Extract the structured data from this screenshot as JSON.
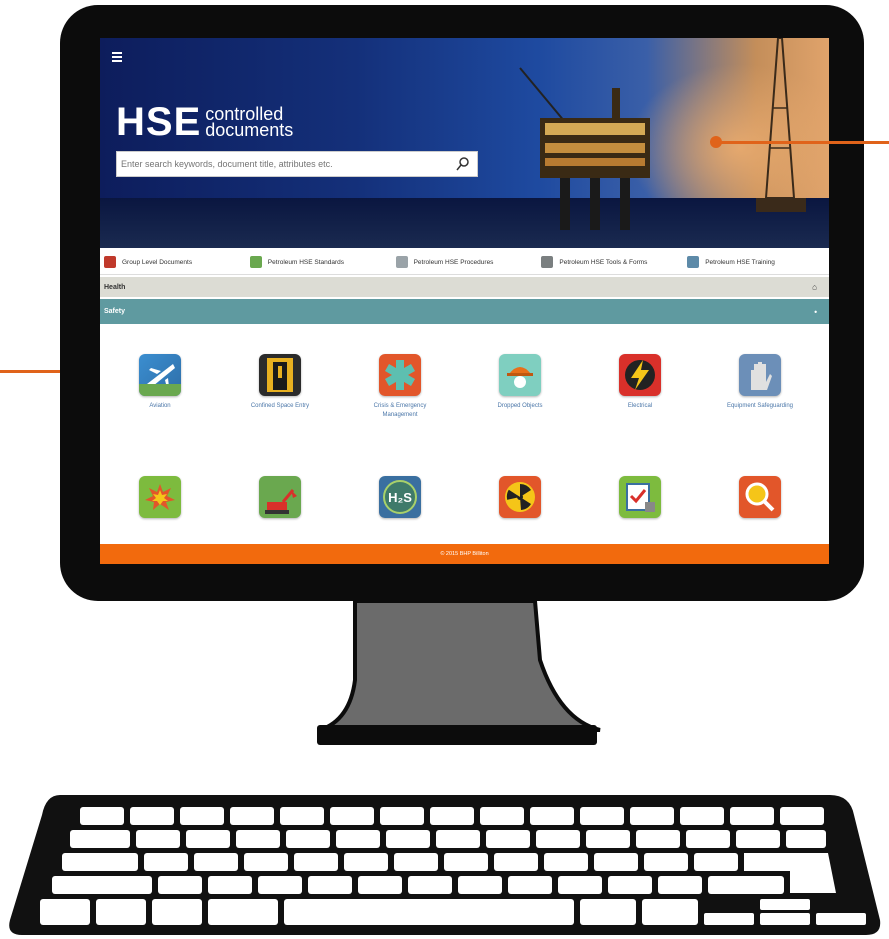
{
  "header": {
    "logo_big": "HSE",
    "logo_small_line1": "controlled",
    "logo_small_line2": "documents",
    "search_placeholder": "Enter search keywords, document title, attributes etc.",
    "menu_icon": "hamburger-icon",
    "search_icon": "magnifier-icon"
  },
  "nav": {
    "tabs": [
      {
        "label": "Group Level Documents",
        "icon": "folder-red-icon",
        "color": "#c0392b"
      },
      {
        "label": "Petroleum HSE Standards",
        "icon": "standards-icon",
        "color": "#6aa84f"
      },
      {
        "label": "Petroleum HSE Procedures",
        "icon": "procedures-icon",
        "color": "#9aa3a8"
      },
      {
        "label": "Petroleum HSE Tools & Forms",
        "icon": "tools-icon",
        "color": "#7a7f80"
      },
      {
        "label": "Petroleum HSE Training",
        "icon": "training-icon",
        "color": "#5d8aa8"
      }
    ]
  },
  "sections": {
    "health": "Health",
    "safety": "Safety"
  },
  "tiles": [
    {
      "label": "Aviation",
      "icon": "airplane-icon",
      "color": "#3b8ed0"
    },
    {
      "label": "Confined Space Entry",
      "icon": "confined-space-icon",
      "color": "#2b2b2b"
    },
    {
      "label": "Crisis & Emergency Management",
      "icon": "star-of-life-icon",
      "color": "#e2562a"
    },
    {
      "label": "Dropped Objects",
      "icon": "hardhat-icon",
      "color": "#7fcfc0"
    },
    {
      "label": "Electrical",
      "icon": "lightning-icon",
      "color": "#d9302a"
    },
    {
      "label": "Equipment Safeguarding",
      "icon": "glove-icon",
      "color": "#6c8fb8"
    },
    {
      "label": "",
      "icon": "explosion-icon",
      "color": "#7dbb3e"
    },
    {
      "label": "",
      "icon": "excavator-icon",
      "color": "#6aa84f"
    },
    {
      "label": "",
      "icon": "h2s-icon",
      "color": "#3f7a6a"
    },
    {
      "label": "",
      "icon": "radiation-icon",
      "color": "#e2562a"
    },
    {
      "label": "",
      "icon": "permit-icon",
      "color": "#7dbb3e"
    },
    {
      "label": "",
      "icon": "magnifier-risk-icon",
      "color": "#e2562a"
    }
  ],
  "footer": {
    "text": "© 2015 BHP Billiton"
  },
  "colors": {
    "accent": "#f26a0d",
    "safety_bar": "#5f9aa0",
    "callout": "#e0631a"
  }
}
